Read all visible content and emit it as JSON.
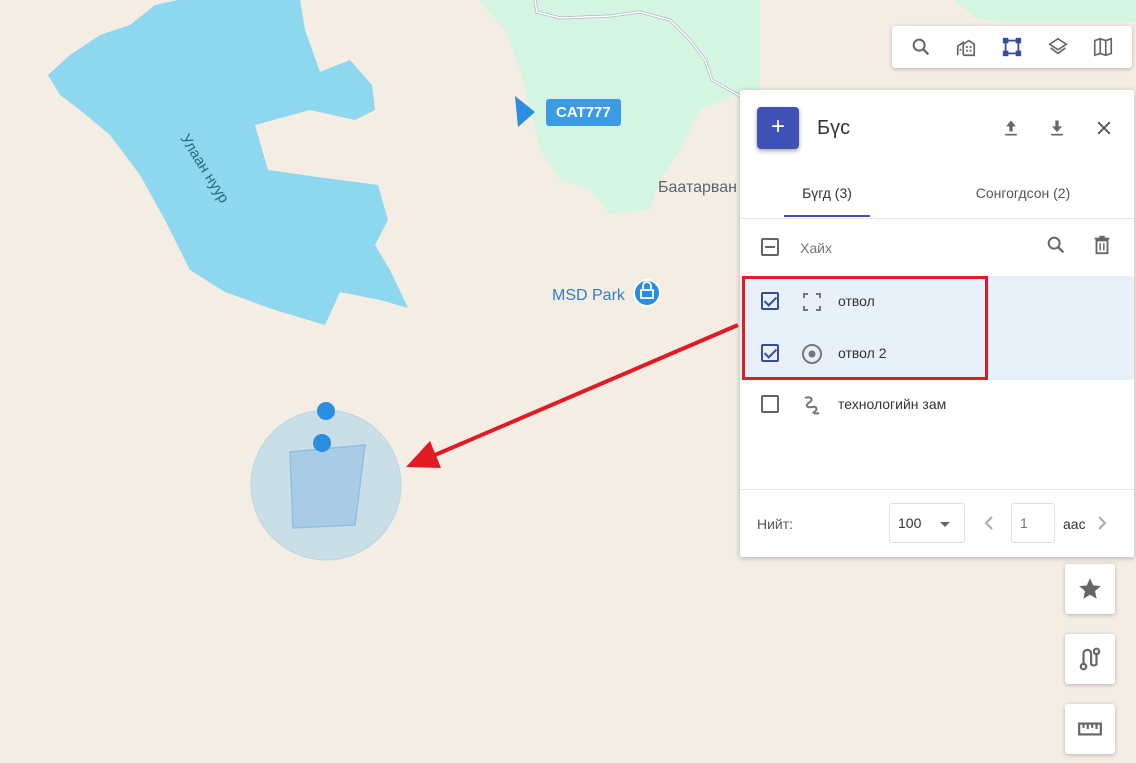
{
  "map": {
    "lake_label": "Улаан нуур",
    "place_label": "Баатарван",
    "poi_label": "MSD Park",
    "vehicle_label": "CAT777",
    "colors": {
      "water": "#8dd7ef",
      "land": "#f3ede3",
      "forest": "#d5f5e3",
      "accent": "#2c8ce0",
      "highlight": "#e01b24"
    }
  },
  "toolbar": {
    "items": [
      {
        "name": "search-icon"
      },
      {
        "name": "buildings-icon"
      },
      {
        "name": "draw-polygon-icon",
        "active": true
      },
      {
        "name": "layers-icon"
      },
      {
        "name": "map-icon"
      }
    ]
  },
  "panel": {
    "add_label": "+",
    "title": "Бүс",
    "tabs": [
      {
        "label": "Бүгд (3)",
        "active": true
      },
      {
        "label": "Сонгогдсон (2)",
        "active": false
      }
    ],
    "search_placeholder": "Хайх",
    "items": [
      {
        "label": "отвол",
        "checked": true,
        "icon": "dashed-square-icon"
      },
      {
        "label": "отвол 2",
        "checked": true,
        "icon": "radio-circle-icon"
      },
      {
        "label": "технологийн зам",
        "checked": false,
        "icon": "route-squiggle-icon"
      }
    ],
    "footer": {
      "total_label": "Нийт:",
      "page_size": "100",
      "page_placeholder": "1",
      "page_suffix": "аас"
    }
  },
  "side_buttons": [
    {
      "name": "star-icon"
    },
    {
      "name": "route-icon"
    },
    {
      "name": "ruler-icon"
    }
  ]
}
